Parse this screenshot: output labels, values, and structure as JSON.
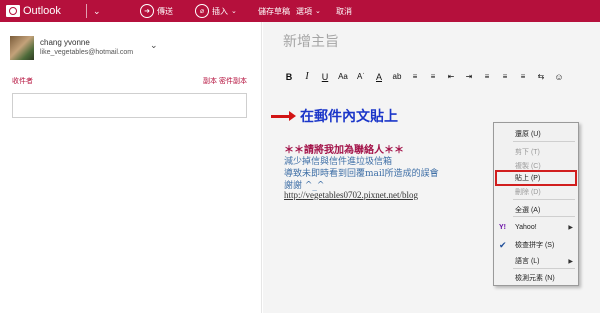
{
  "topbar": {
    "brand": "Outlook",
    "send_label": "傳送",
    "insert_label": "插入",
    "save_draft_label": "儲存草稿",
    "options_label": "選項",
    "cancel_label": "取消",
    "color": "#b5103c"
  },
  "account": {
    "name": "chang yvonne",
    "email": "like_vegetables@hotmail.com"
  },
  "recipients": {
    "to_label": "收件者",
    "cc_bcc_label": "副本 密件副本",
    "to_value": ""
  },
  "compose": {
    "subject_placeholder": "新增主旨",
    "toolbar": [
      "B",
      "I",
      "U",
      "Aa",
      "A˙",
      "A",
      "ab",
      "≡",
      "≡",
      "⇤",
      "⇥",
      "≡",
      "≡",
      "≡",
      "⇆",
      "☺"
    ],
    "body_title": "在郵件內文貼上",
    "signature": [
      "＊＊請將我加為聯絡人＊＊",
      "減少掉信與信件進垃圾信箱",
      "導致未即時看到回覆mail所造成的誤會",
      "謝謝 ^_^"
    ],
    "signature_link": "http://vegetables0702.pixnet.net/blog"
  },
  "context_menu": {
    "items": [
      {
        "label": "還原 (U)",
        "disabled": false
      },
      {
        "label": "剪下 (T)",
        "disabled": true
      },
      {
        "label": "複製 (C)",
        "disabled": true
      },
      {
        "label": "貼上 (P)",
        "disabled": false,
        "highlighted": true
      },
      {
        "label": "刪除 (D)",
        "disabled": true
      },
      {
        "label": "全選 (A)",
        "disabled": false
      },
      {
        "label": "Yahoo!",
        "disabled": false,
        "submenu": true
      },
      {
        "label": "檢查拼字 (S)",
        "disabled": false,
        "checked": true
      },
      {
        "label": "語言 (L)",
        "disabled": false,
        "submenu": true
      },
      {
        "label": "檢測元素 (N)",
        "disabled": false
      }
    ],
    "highlight_color": "#d11e1e"
  }
}
